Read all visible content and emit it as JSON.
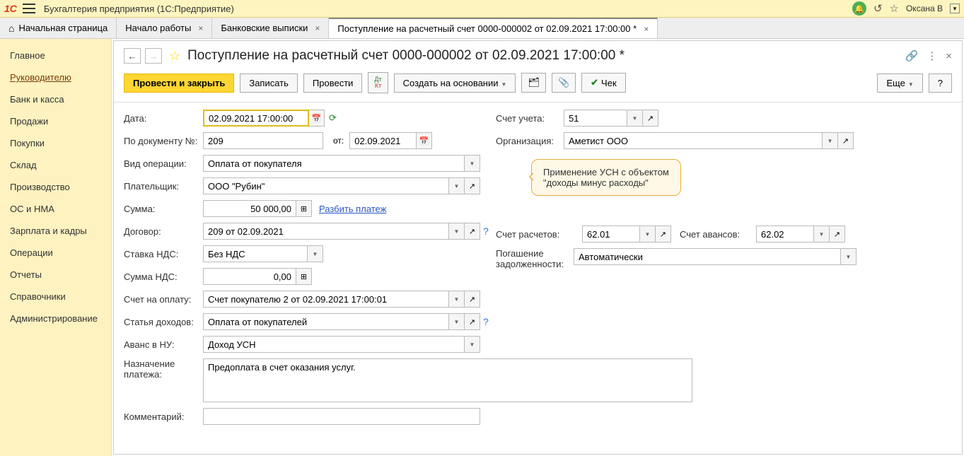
{
  "titlebar": {
    "logo": "1C",
    "app_title": "Бухгалтерия предприятия  (1С:Предприятие)",
    "username": "Оксана В"
  },
  "tabs": {
    "home": "Начальная страница",
    "items": [
      {
        "label": "Начало работы"
      },
      {
        "label": "Банковские выписки"
      },
      {
        "label": "Поступление на расчетный счет 0000-000002 от 02.09.2021 17:00:00 *",
        "active": true
      }
    ]
  },
  "sidebar": {
    "items": [
      "Главное",
      "Руководителю",
      "Банк и касса",
      "Продажи",
      "Покупки",
      "Склад",
      "Производство",
      "ОС и НМА",
      "Зарплата и кадры",
      "Операции",
      "Отчеты",
      "Справочники",
      "Администрирование"
    ],
    "active": 1
  },
  "doc": {
    "title": "Поступление на расчетный счет 0000-000002 от 02.09.2021 17:00:00 *"
  },
  "toolbar": {
    "post_close": "Провести и закрыть",
    "write": "Записать",
    "post": "Провести",
    "create_based": "Создать на основании",
    "check": "Чек",
    "more": "Еще",
    "help": "?"
  },
  "form": {
    "date_label": "Дата:",
    "date_value": "02.09.2021 17:00:00",
    "docnum_label": "По документу №:",
    "docnum_value": "209",
    "from_label": "от:",
    "from_value": "02.09.2021",
    "optype_label": "Вид операции:",
    "optype_value": "Оплата от покупателя",
    "payer_label": "Плательщик:",
    "payer_value": "ООО \"Рубин\"",
    "sum_label": "Сумма:",
    "sum_value": "50 000,00",
    "split_link": "Разбить платеж",
    "contract_label": "Договор:",
    "contract_value": "209 от 02.09.2021",
    "vat_rate_label": "Ставка НДС:",
    "vat_rate_value": "Без НДС",
    "vat_sum_label": "Сумма НДС:",
    "vat_sum_value": "0,00",
    "invoice_label": "Счет на оплату:",
    "invoice_value": "Счет покупателю 2 от 02.09.2021 17:00:01",
    "income_item_label": "Статья доходов:",
    "income_item_value": "Оплата от покупателей",
    "advance_label": "Аванс в НУ:",
    "advance_value": "Доход УСН",
    "purpose_label1": "Назначение",
    "purpose_label2": "платежа:",
    "purpose_value": "Предоплата в счет оказания услуг.",
    "comment_label": "Комментарий:",
    "comment_value": ""
  },
  "right": {
    "account_label": "Счет учета:",
    "account_value": "51",
    "org_label": "Организация:",
    "org_value": "Аметист ООО",
    "settle_acc_label": "Счет расчетов:",
    "settle_acc_value": "62.01",
    "advance_acc_label": "Счет авансов:",
    "advance_acc_value": "62.02",
    "debt_label1": "Погашение",
    "debt_label2": "задолженности:",
    "debt_value": "Автоматически"
  },
  "callout": {
    "line1": "Применение УСН с объектом",
    "line2": "\"доходы минус расходы\""
  }
}
